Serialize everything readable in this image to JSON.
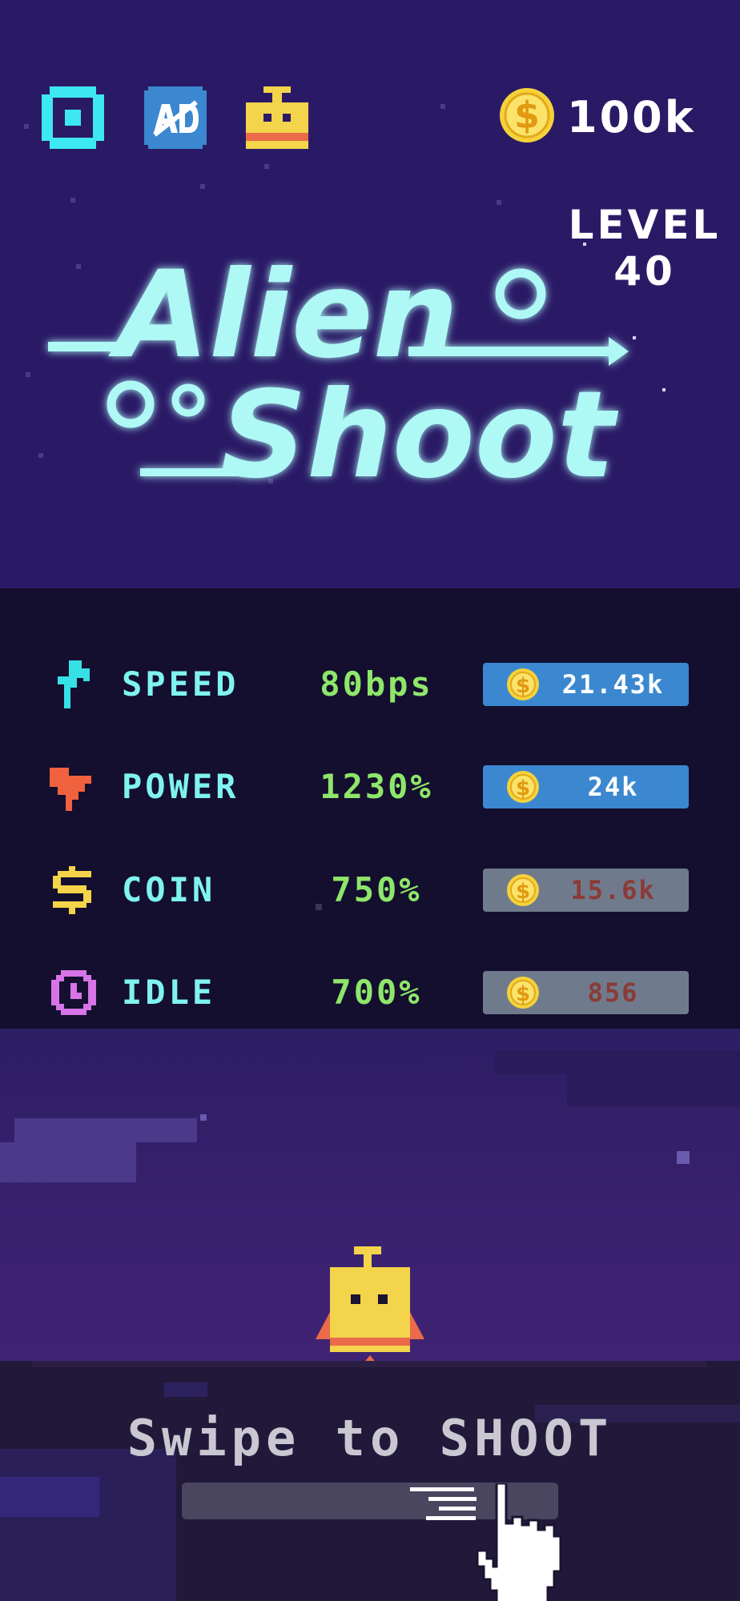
{
  "header": {
    "coins": "100k",
    "level_label": "LEVEL",
    "level_number": "40"
  },
  "logo": {
    "line1": "Alien",
    "line2": "Shoot"
  },
  "upgrades": [
    {
      "label": "SPEED",
      "value": "80bps",
      "price": "21.43k",
      "affordable": true,
      "icon": "lightning-icon",
      "icon_color": "#35e0e6"
    },
    {
      "label": "POWER",
      "value": "1230%",
      "price": "24k",
      "affordable": true,
      "icon": "power-bolt-icon",
      "icon_color": "#f0613d"
    },
    {
      "label": "COIN",
      "value": "750%",
      "price": "15.6k",
      "affordable": false,
      "icon": "dollar-icon",
      "icon_color": "#f3d44a"
    },
    {
      "label": "IDLE",
      "value": "700%",
      "price": "856",
      "affordable": false,
      "icon": "clock-icon",
      "icon_color": "#d774e8"
    }
  ],
  "footer": {
    "instruction": "Swipe to SHOOT"
  },
  "colors": {
    "logo_cyan": "#aef8f6",
    "button_blue": "#3b88d0",
    "button_gray": "#6f7b8c",
    "value_green": "#8ee66a",
    "label_cyan": "#7ff3f0"
  }
}
